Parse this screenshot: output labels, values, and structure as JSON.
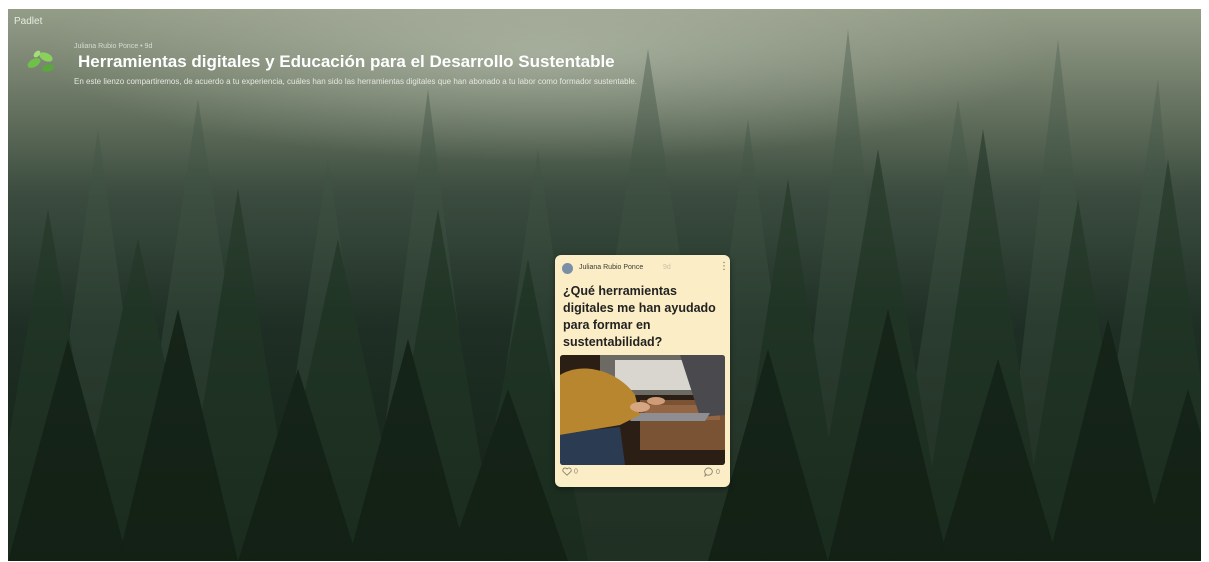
{
  "app": {
    "brand": "Padlet"
  },
  "header": {
    "author_line": "Juliana Rubio Ponce • 9d",
    "title": "Herramientas digitales y Educación para el Desarrollo Sustentable",
    "description": "En este lienzo compartiremos, de acuerdo a tu experiencia, cuáles han sido las herramientas digitales que han abonado a tu labor como formador sustentable."
  },
  "post": {
    "author": "Juliana Rubio Ponce",
    "time": "9d",
    "title": "¿Qué herramientas digitales me han ayudado para formar en sustentabilidad?",
    "likes": "0",
    "comments": "0"
  },
  "icons": {
    "logo": "leaves-logo-icon",
    "kebab": "more-options-icon",
    "like": "heart-icon",
    "comment": "comment-bubble-icon"
  },
  "colors": {
    "post_background": "#fbeec6",
    "forest_dark": "#1f2f25",
    "logo_green": "#6fbf4a"
  }
}
